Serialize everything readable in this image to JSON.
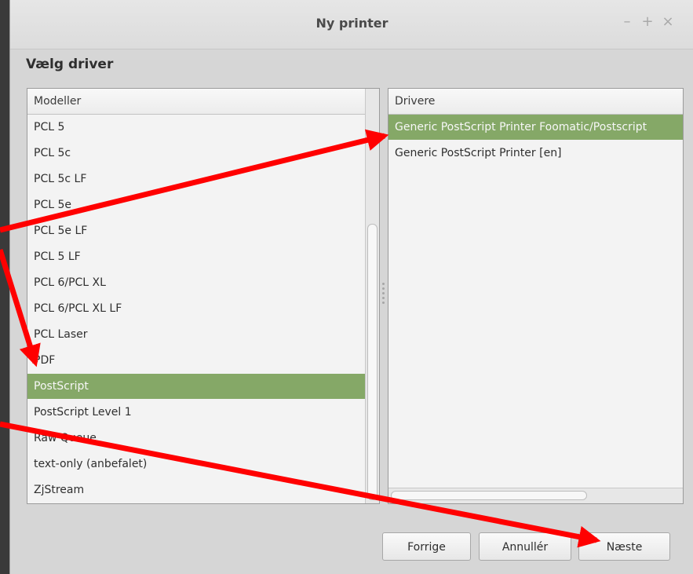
{
  "window": {
    "title": "Ny printer",
    "controls": {
      "minimize": "–",
      "maximize": "+",
      "close": "×"
    }
  },
  "page": {
    "heading": "Vælg driver"
  },
  "models": {
    "header": "Modeller",
    "items": [
      "PCL 5",
      "PCL 5c",
      "PCL 5c LF",
      "PCL 5e",
      "PCL 5e LF",
      "PCL 5 LF",
      "PCL 6/PCL XL",
      "PCL 6/PCL XL LF",
      "PCL Laser",
      "PDF",
      "PostScript",
      "PostScript Level 1",
      "Raw Queue",
      "text-only (anbefalet)",
      "ZjStream"
    ],
    "selected": "PostScript"
  },
  "drivers": {
    "header": "Drivere",
    "items": [
      "Generic PostScript Printer Foomatic/Postscript",
      "Generic PostScript Printer [en]"
    ],
    "selected": "Generic PostScript Printer Foomatic/Postscript"
  },
  "buttons": {
    "back": "Forrige",
    "cancel": "Annullér",
    "next": "Næste"
  },
  "colors": {
    "selection": "#85a867",
    "annotation_arrow": "#ff0000"
  }
}
